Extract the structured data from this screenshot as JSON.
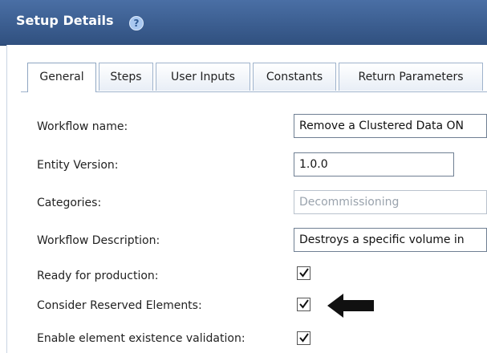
{
  "header": {
    "title": "Setup Details",
    "help_icon": "question-icon"
  },
  "tabs": [
    {
      "label": "General",
      "active": true
    },
    {
      "label": "Steps"
    },
    {
      "label": "User Inputs"
    },
    {
      "label": "Constants"
    },
    {
      "label": "Return Parameters"
    }
  ],
  "form": {
    "workflow_name": {
      "label": "Workflow name:",
      "value": "Remove a Clustered Data ON"
    },
    "entity_version": {
      "label": "Entity Version:",
      "value": "1.0.0"
    },
    "categories": {
      "label": "Categories:",
      "value": "Decommissioning"
    },
    "workflow_description": {
      "label": "Workflow Description:",
      "value": "Destroys a specific volume in"
    },
    "ready_for_production": {
      "label": "Ready for production:",
      "checked": true
    },
    "consider_reserved_elements": {
      "label": "Consider Reserved Elements:",
      "checked": true
    },
    "enable_element_existence_validation": {
      "label": "Enable element existence validation:",
      "checked": true
    }
  },
  "callout": {
    "icon": "left-arrow-icon"
  }
}
